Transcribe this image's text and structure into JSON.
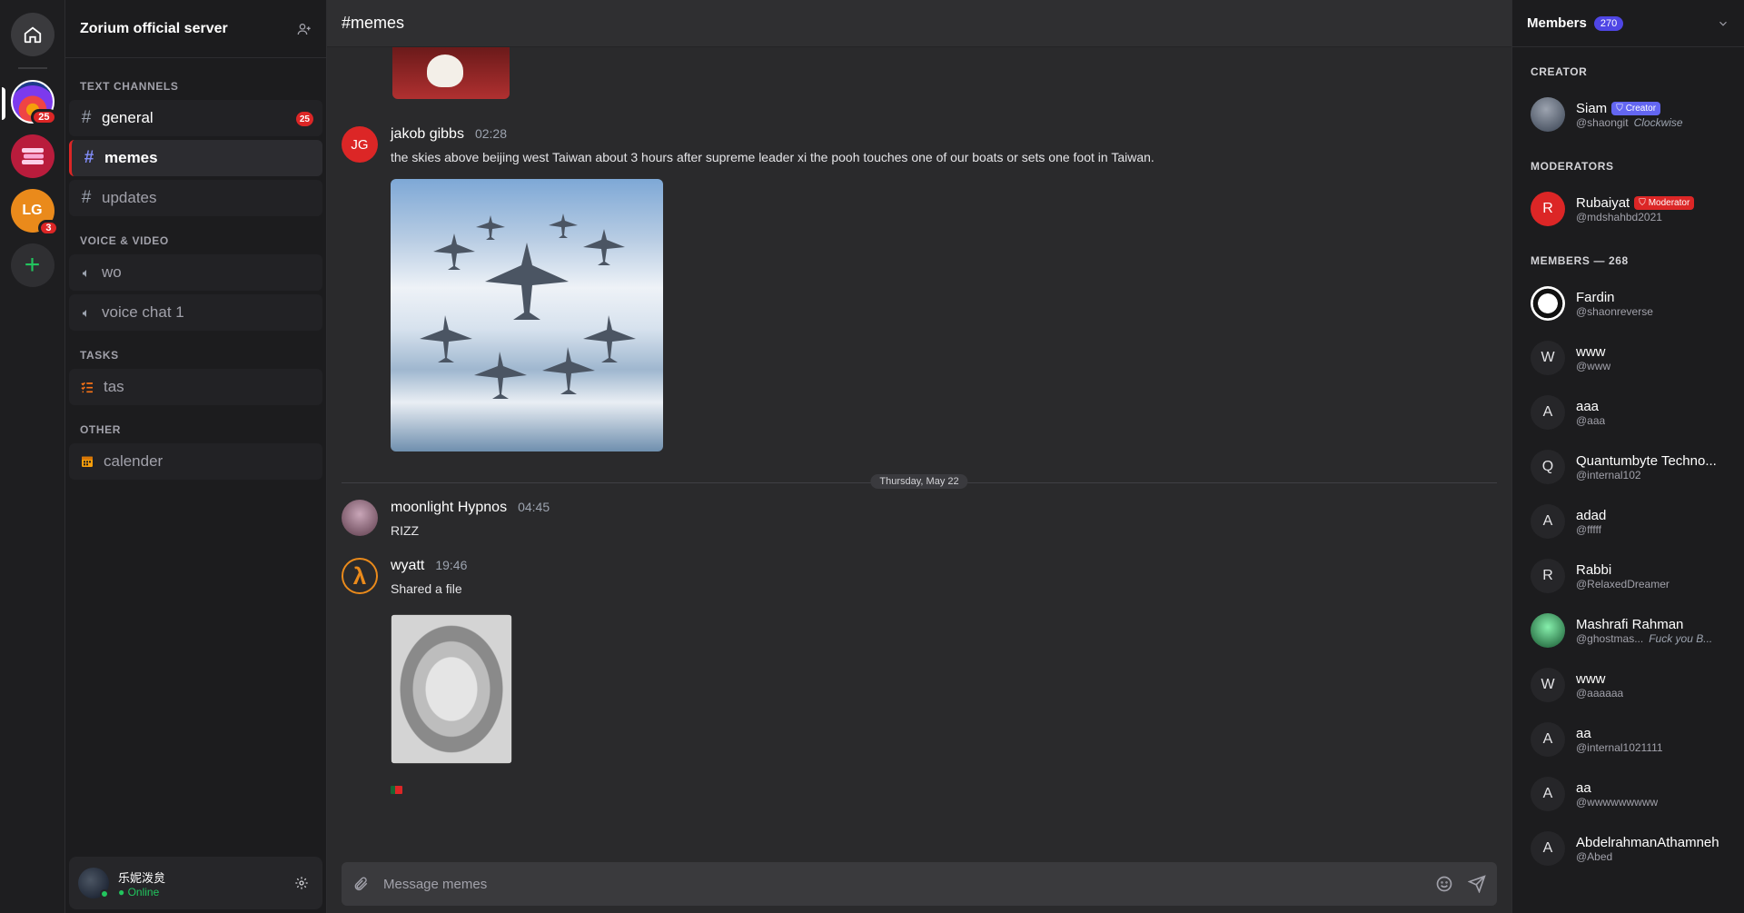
{
  "servers": {
    "badge_1": "25",
    "lg_initials": "LG",
    "badge_lg": "3",
    "add": "+"
  },
  "sidebar": {
    "server_name": "Zorium official server",
    "categories": {
      "text": "TEXT CHANNELS",
      "voice": "VOICE & VIDEO",
      "tasks": "TASKS",
      "other": "OTHER"
    },
    "channels": {
      "general": "general",
      "general_badge": "25",
      "memes": "memes",
      "updates": "updates",
      "wo": "wo",
      "voice1": "voice chat 1",
      "tas": "tas",
      "calender": "calender"
    },
    "user": {
      "name": "乐妮泼炱",
      "status": "● Online"
    }
  },
  "chat": {
    "channel_title": "#memes",
    "messages": [
      {
        "initials": "JG",
        "author": "jakob gibbs",
        "time": "02:28",
        "text": "the skies above beijing west Taiwan about 3 hours after supreme leader xi the pooh touches one of our boats or sets one foot in Taiwan."
      },
      {
        "author": "moonlight Hypnos",
        "time": "04:45",
        "text": "RIZZ"
      },
      {
        "author": "wyatt",
        "time": "19:46",
        "text": "Shared a file"
      }
    ],
    "date_divider": "Thursday, May 22",
    "composer_placeholder": "Message memes"
  },
  "members": {
    "title": "Members",
    "count": "270",
    "creator_cat": "CREATOR",
    "mod_cat": "MODERATORS",
    "members_cat": "MEMBERS — 268",
    "creator": {
      "name": "Siam",
      "role": "Creator",
      "handle": "@shaongit",
      "status": "Clockwise"
    },
    "moderator": {
      "initial": "R",
      "name": "Rubaiyat",
      "role": "Moderator",
      "handle": "@mdshahbd2021"
    },
    "list": [
      {
        "initial": "",
        "name": "Fardin",
        "handle": "@shaonreverse",
        "status": ""
      },
      {
        "initial": "W",
        "name": "www",
        "handle": "@www",
        "status": ""
      },
      {
        "initial": "A",
        "name": "aaa",
        "handle": "@aaa",
        "status": ""
      },
      {
        "initial": "Q",
        "name": "Quantumbyte Techno...",
        "handle": "@internal102",
        "status": ""
      },
      {
        "initial": "A",
        "name": "adad",
        "handle": "@fffff",
        "status": ""
      },
      {
        "initial": "R",
        "name": "Rabbi",
        "handle": "@RelaxedDreamer",
        "status": ""
      },
      {
        "initial": "",
        "name": "Mashrafi Rahman",
        "handle": "@ghostmas...",
        "status": "Fuck you B..."
      },
      {
        "initial": "W",
        "name": "www",
        "handle": "@aaaaaa",
        "status": ""
      },
      {
        "initial": "A",
        "name": "aa",
        "handle": "@internal1021111",
        "status": ""
      },
      {
        "initial": "A",
        "name": "aa",
        "handle": "@wwwwwwwww",
        "status": ""
      },
      {
        "initial": "A",
        "name": "AbdelrahmanAthamneh",
        "handle": "@Abed",
        "status": ""
      }
    ]
  },
  "colors": {
    "accent": "#6366f1",
    "danger": "#dc2626",
    "online": "#22c55e"
  }
}
